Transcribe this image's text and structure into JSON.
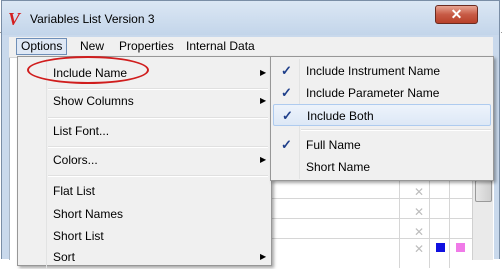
{
  "window": {
    "title": "Variables List Version 3",
    "close_label": "✕"
  },
  "menubar": {
    "items": [
      {
        "label": "Options"
      },
      {
        "label": "New"
      },
      {
        "label": "Properties"
      },
      {
        "label": "Internal Data"
      }
    ]
  },
  "options_menu": {
    "items": [
      {
        "label": "Include Name",
        "has_submenu": true
      },
      {
        "label": "Show Columns",
        "has_submenu": true
      },
      {
        "label": "List Font..."
      },
      {
        "label": "Colors...",
        "has_submenu": true
      },
      {
        "label": "Flat List"
      },
      {
        "label": "Short Names"
      },
      {
        "label": "Short List"
      },
      {
        "label": "Sort",
        "has_submenu": true
      }
    ]
  },
  "include_name_submenu": {
    "items": [
      {
        "label": "Include Instrument Name",
        "checked": true
      },
      {
        "label": "Include Parameter Name",
        "checked": true
      },
      {
        "label": "Include Both",
        "checked": true
      },
      {
        "label": "Full Name",
        "checked": true
      },
      {
        "label": "Short Name",
        "checked": false
      }
    ],
    "check_glyph": "✓"
  },
  "arrow_glyph": "▶",
  "colors": {
    "annotation": "#d01d1d",
    "blue_square": "#1010e0",
    "pink_square": "#f07ae8"
  }
}
